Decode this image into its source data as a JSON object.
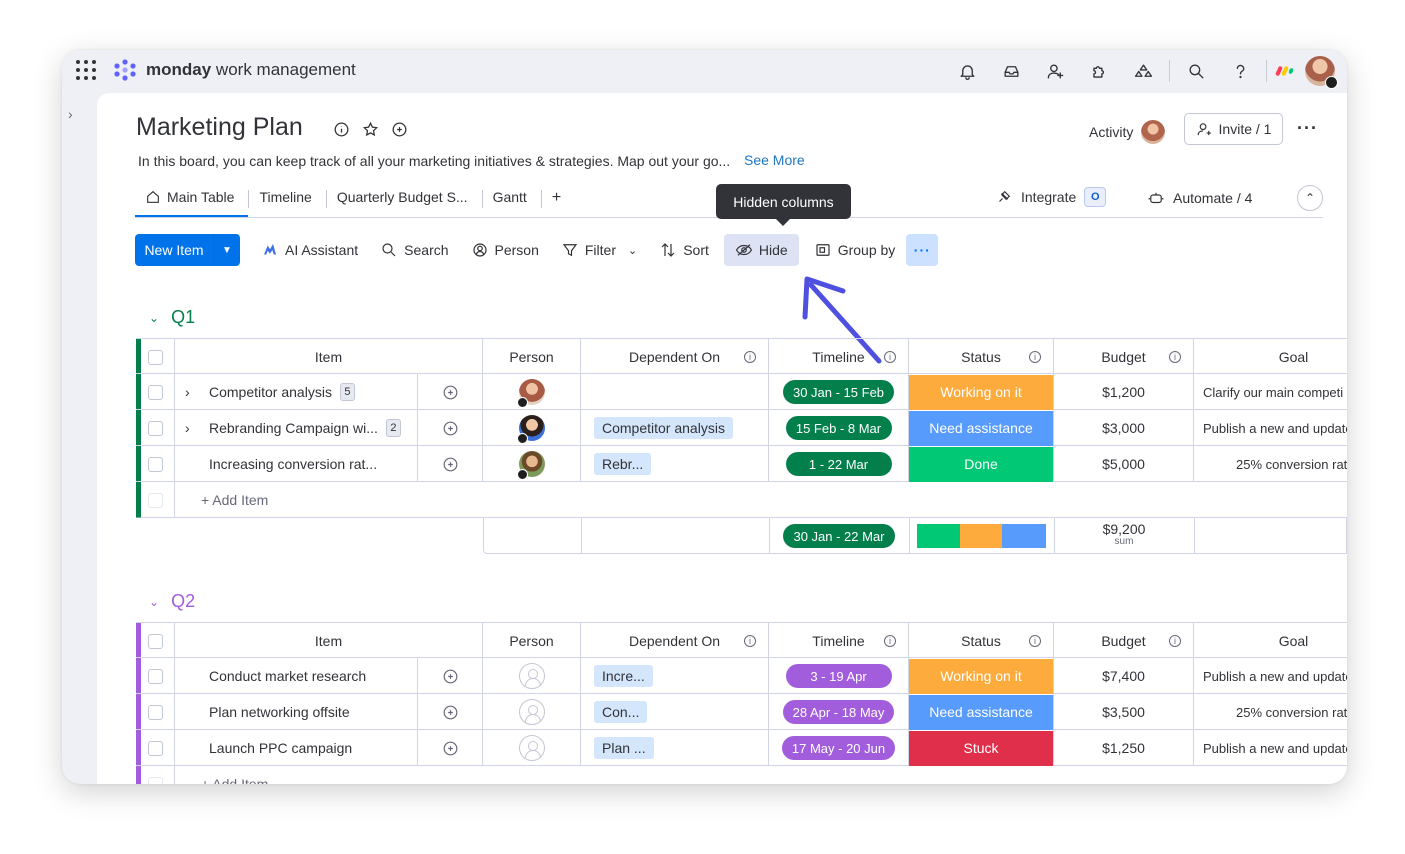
{
  "app": {
    "brand": "monday",
    "product": "work management"
  },
  "board": {
    "title": "Marketing Plan",
    "description": "In this board, you can keep track of all your marketing initiatives & strategies. Map out your go...",
    "see_more": "See More",
    "activity_label": "Activity",
    "invite_label": "Invite / 1"
  },
  "tabs": [
    {
      "label": "Main Table"
    },
    {
      "label": "Timeline"
    },
    {
      "label": "Quarterly Budget S..."
    },
    {
      "label": "Gantt"
    },
    {
      "label": "+"
    }
  ],
  "right_actions": {
    "integrate": "Integrate",
    "automate": "Automate / 4"
  },
  "tooltip": "Hidden columns",
  "toolbar": {
    "new_item": "New Item",
    "ai": "AI Assistant",
    "search": "Search",
    "person": "Person",
    "filter": "Filter",
    "sort": "Sort",
    "hide": "Hide",
    "group_by": "Group by"
  },
  "columns": [
    "Item",
    "Person",
    "Dependent On",
    "Timeline",
    "Status",
    "Budget",
    "Goal"
  ],
  "colors": {
    "q1": "#037f4c",
    "q2": "#a25ddc",
    "working": "#fdab3d",
    "assist": "#579bfc",
    "done": "#00c875",
    "stuck": "#df2f4a",
    "accent": "#0073ea"
  },
  "groups": [
    {
      "name": "Q1",
      "rows": [
        {
          "item": "Competitor analysis",
          "count": "5",
          "person": "avatar-woman",
          "dep": "",
          "timeline": "30 Jan - 15 Feb",
          "status": "Working on it",
          "budget": "$1,200",
          "goal": "Clarify our main competi"
        },
        {
          "item": "Rebranding Campaign wi...",
          "count": "2",
          "person": "avatar-woman-2",
          "dep": "Competitor analysis",
          "timeline": "15 Feb - 8 Mar",
          "status": "Need assistance",
          "budget": "$3,000",
          "goal": "Publish a new and update"
        },
        {
          "item": "Increasing conversion rat...",
          "count": "",
          "person": "avatar-man",
          "dep": "Rebr...",
          "timeline": "1 - 22 Mar",
          "status": "Done",
          "budget": "$5,000",
          "goal": "25% conversion rat"
        }
      ],
      "add_item": "+ Add Item",
      "summary": {
        "timeline": "30 Jan - 22 Mar",
        "budget": "$9,200",
        "budget_label": "sum",
        "status_bar": [
          0.33,
          0.33,
          0.34
        ]
      }
    },
    {
      "name": "Q2",
      "rows": [
        {
          "item": "Conduct market research",
          "count": "",
          "person": "",
          "dep": "Incre...",
          "timeline": "3 - 19 Apr",
          "status": "Working on it",
          "budget": "$7,400",
          "goal": "Publish a new and update"
        },
        {
          "item": "Plan networking offsite",
          "count": "",
          "person": "",
          "dep": "Con...",
          "timeline": "28 Apr - 18 May",
          "status": "Need assistance",
          "budget": "$3,500",
          "goal": "25% conversion rat"
        },
        {
          "item": "Launch PPC campaign",
          "count": "",
          "person": "",
          "dep": "Plan ...",
          "timeline": "17 May - 20 Jun",
          "status": "Stuck",
          "budget": "$1,250",
          "goal": "Publish a new and update"
        }
      ],
      "add_item": "+ Add Item"
    }
  ]
}
